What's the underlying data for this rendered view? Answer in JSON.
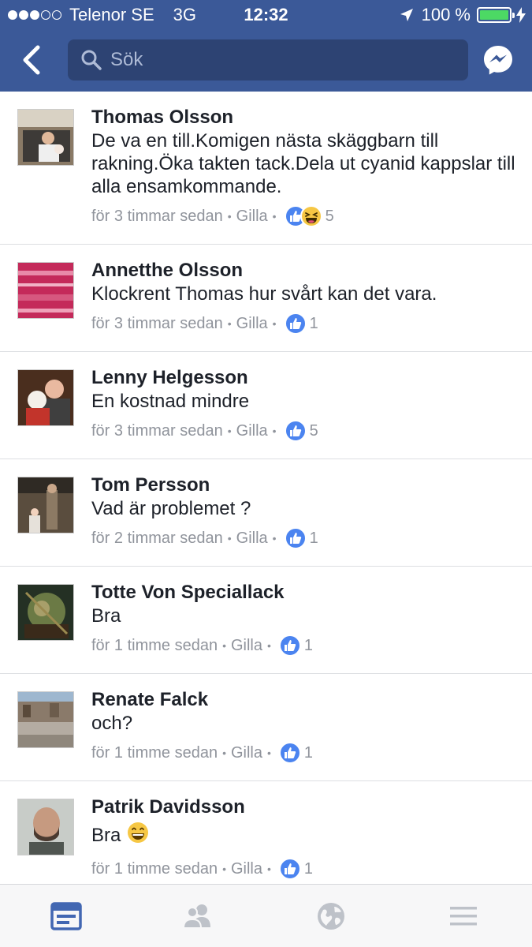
{
  "status_bar": {
    "carrier": "Telenor SE",
    "network": "3G",
    "time": "12:32",
    "battery": "100 %",
    "battery_level": 1.0
  },
  "nav": {
    "search_placeholder": "Sök"
  },
  "comments": [
    {
      "name": "Thomas Olsson",
      "text": "De va en till.Komigen nästa skäggbarn till rakning.Öka takten tack.Dela ut cyanid kappslar till alla ensamkommande.",
      "time": "för 3 timmar sedan",
      "like_label": "Gilla",
      "reactions": [
        "like",
        "haha"
      ],
      "count": "5"
    },
    {
      "name": "Annetthe Olsson",
      "text": "Klockrent Thomas hur svårt kan det vara.",
      "time": "för 3 timmar sedan",
      "like_label": "Gilla",
      "reactions": [
        "like"
      ],
      "count": "1"
    },
    {
      "name": "Lenny Helgesson",
      "text": "En kostnad mindre",
      "time": "för 3 timmar sedan",
      "like_label": "Gilla",
      "reactions": [
        "like"
      ],
      "count": "5"
    },
    {
      "name": "Tom Persson",
      "text": "Vad är problemet ?",
      "time": "för 2 timmar sedan",
      "like_label": "Gilla",
      "reactions": [
        "like"
      ],
      "count": "1"
    },
    {
      "name": "Totte Von Speciallack",
      "text": "Bra",
      "time": "för 1 timme sedan",
      "like_label": "Gilla",
      "reactions": [
        "like"
      ],
      "count": "1"
    },
    {
      "name": "Renate Falck",
      "text": "och?",
      "time": "för 1 timme sedan",
      "like_label": "Gilla",
      "reactions": [
        "like"
      ],
      "count": "1"
    },
    {
      "name": "Patrik Davidsson",
      "text": "Bra",
      "text_emoji": "grinning-face-emoji",
      "time": "för 1 timme sedan",
      "like_label": "Gilla",
      "reactions": [
        "like"
      ],
      "count": "1"
    }
  ],
  "tabbar": {
    "tabs": [
      "news-feed-icon",
      "friends-icon",
      "notifications-globe-icon",
      "menu-icon"
    ],
    "active_color": "#4267b2",
    "inactive_color": "#bec2c9"
  },
  "colors": {
    "header": "#3b5998",
    "like_blue": "#4b84f0",
    "haha_yellow": "#f6c744"
  }
}
